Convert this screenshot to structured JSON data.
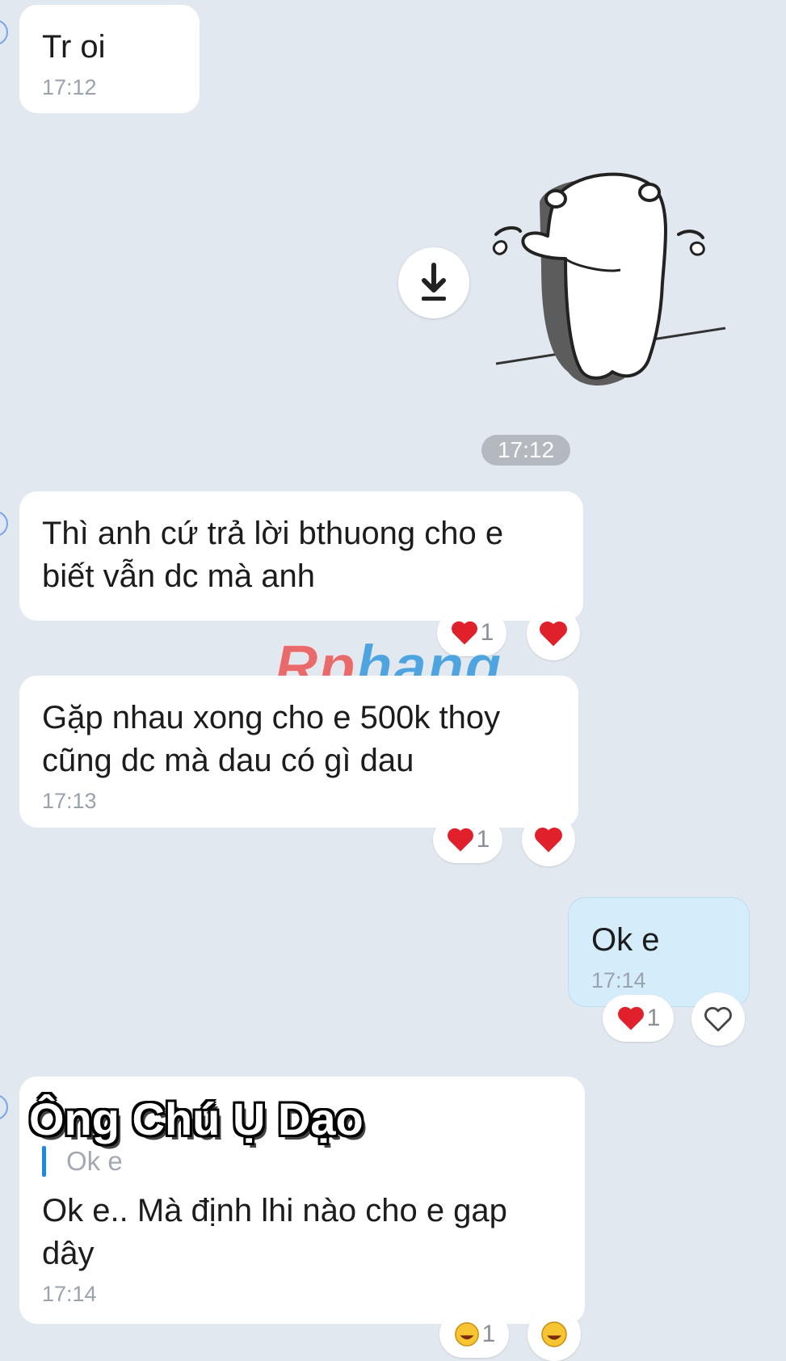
{
  "messages": [
    {
      "text": "Tr oi",
      "time": "17:12"
    },
    {
      "text": "Thì anh cứ trả lời bthuong cho e biết vẫn dc mà anh"
    },
    {
      "text": "Gặp nhau xong cho e 500k thoy cũng dc mà dau có gì dau",
      "time": "17:13"
    },
    {
      "text": "Ok e",
      "time": "17:14"
    },
    {
      "quote": "Ok e",
      "text": "Ok e.. Mà định lhi nào cho e gap dây",
      "time": "17:14"
    }
  ],
  "sticker": {
    "icon": "crying-bear-sticker",
    "time": "17:12"
  },
  "reactions": {
    "heart_count_1": "1",
    "heart_count_2": "1",
    "heart_count_3": "1",
    "laugh_count": "1"
  },
  "watermark": {
    "part1": "Rp",
    "part2": "hang"
  },
  "overlay_name": "Ông Chú Ụ Dạo",
  "colors": {
    "background": "#e2e8f0",
    "my_bubble": "#d5ecfb",
    "heart": "#e0202a",
    "quote_bar": "#1e88e5"
  }
}
